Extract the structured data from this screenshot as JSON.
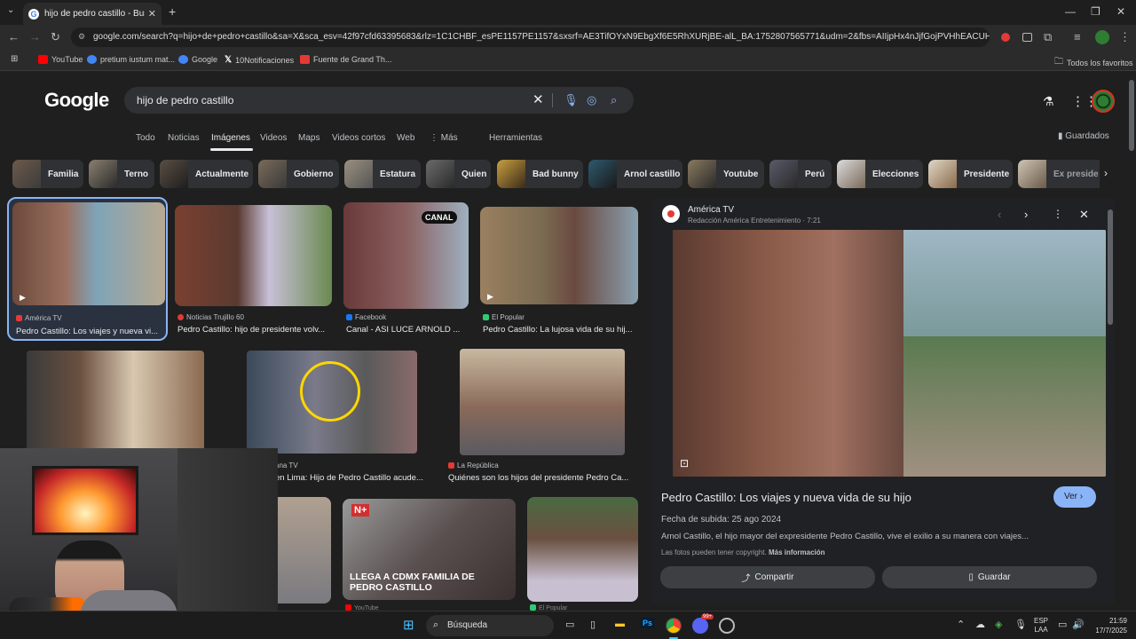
{
  "browser": {
    "tab_title": "hijo de pedro castillo - Buscar c",
    "url": "google.com/search?q=hijo+de+pedro+castillo&sa=X&sca_esv=42f97cfd63395683&rlz=1C1CHBF_esPE1157PE1157&sxsrf=AE3TifOYxN9EbgXf6E5RhXURjBE-alL_BA:1752807565771&udm=2&fbs=AIIjpHx4nJjfGojPVHhEACUHPiMQKBUqzT...",
    "bookmarks": [
      {
        "label": "YouTube",
        "color": "#ff0000"
      },
      {
        "label": "pretium iustum mat...",
        "color": "#4285f4"
      },
      {
        "label": "Google",
        "color": "#4285f4"
      },
      {
        "label": "10Notificaciones",
        "color": "#ffffff"
      },
      {
        "label": "Fuente de Grand Th...",
        "color": "#e53935"
      }
    ],
    "all_favorites": "Todos los favoritos"
  },
  "google": {
    "logo": "Google",
    "query": "hijo de pedro castillo",
    "tabs": [
      "Todo",
      "Noticias",
      "Imágenes",
      "Videos",
      "Maps",
      "Videos cortos",
      "Web",
      "Más"
    ],
    "tools": "Herramientas",
    "saved": "Guardados",
    "chips": [
      "Familia",
      "Terno",
      "Actualmente",
      "Gobierno",
      "Estatura",
      "Quien",
      "Bad bunny",
      "Arnol castillo",
      "Youtube",
      "Perú",
      "Elecciones",
      "Presidente",
      "Ex preside"
    ]
  },
  "results": [
    {
      "source": "América TV",
      "title": "Pedro Castillo: Los viajes y nueva vi...",
      "color": "#e53935"
    },
    {
      "source": "Noticias Trujillo 60",
      "title": "Pedro Castillo: hijo de presidente volv...",
      "color": "#e53935"
    },
    {
      "source": "Facebook",
      "title": "Canal - ASI LUCE ARNOLD ...",
      "color": "#1877f2"
    },
    {
      "source": "El Popular",
      "title": "Pedro Castillo: La lujosa vida de su hij...",
      "color": "#2ecc71"
    },
    {
      "source": "ana TV",
      "title": "en Lima: Hijo de Pedro Castillo acude...",
      "color": "#e53935"
    },
    {
      "source": "La República",
      "title": "Quiénes son los hijos del presidente Pedro Ca...",
      "color": "#e53935"
    },
    {
      "source": "YouTube",
      "title": "",
      "color": "#ff0000"
    },
    {
      "source": "El Popular",
      "title": "",
      "color": "#2ecc71"
    }
  ],
  "thumb_overlays": {
    "canal": "CANAL",
    "n_plus": "N+",
    "news_caption": "LLEGA A CDMX FAMILIA DE PEDRO CASTILLO"
  },
  "preview": {
    "source": "América TV",
    "byline": "Redacción América Entretenimiento · 7:21",
    "title": "Pedro Castillo: Los viajes y nueva vida de su hijo",
    "visit": "Ver",
    "date": "Fecha de subida: 25 ago 2024",
    "description": "Arnol Castillo, el hijo mayor del expresidente Pedro Castillo, vive el exilio a su manera con viajes...",
    "copyright": "Las fotos pueden tener copyright.",
    "more_info": "Más información",
    "share": "Compartir",
    "save": "Guardar"
  },
  "taskbar": {
    "search": "Búsqueda",
    "lang1": "ESP",
    "lang2": "LAA",
    "time": "21:59",
    "date": "17/7/2025",
    "badge": "99+"
  }
}
